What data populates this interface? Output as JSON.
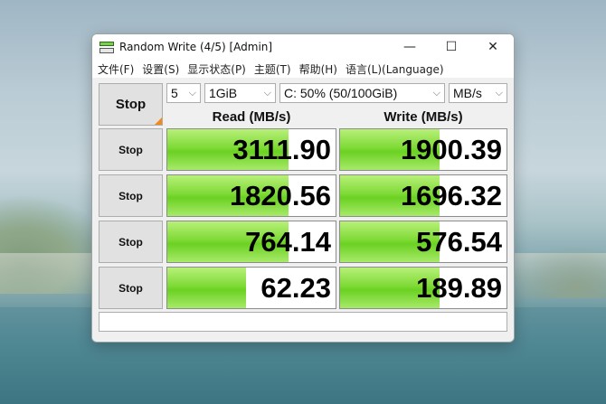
{
  "window": {
    "title": "Random Write (4/5) [Admin]",
    "minimize": "—",
    "maximize": "☐",
    "close": "✕"
  },
  "menu": [
    "文件(F)",
    "设置(S)",
    "显示状态(P)",
    "主题(T)",
    "帮助(H)",
    "语言(L)(Language)"
  ],
  "controls": {
    "main_button": "Stop",
    "count": "5",
    "size": "1GiB",
    "drive": "C: 50% (50/100GiB)",
    "unit": "MB/s"
  },
  "headers": {
    "read": "Read (MB/s)",
    "write": "Write (MB/s)"
  },
  "rows": [
    {
      "button": "Stop",
      "read": "3111.90",
      "read_fill": 0.72,
      "write": "1900.39",
      "write_fill": 0.6
    },
    {
      "button": "Stop",
      "read": "1820.56",
      "read_fill": 0.72,
      "write": "1696.32",
      "write_fill": 0.6
    },
    {
      "button": "Stop",
      "read": "764.14",
      "read_fill": 0.72,
      "write": "576.54",
      "write_fill": 0.6
    },
    {
      "button": "Stop",
      "read": "62.23",
      "read_fill": 0.47,
      "write": "189.89",
      "write_fill": 0.6
    }
  ],
  "status_text": ""
}
